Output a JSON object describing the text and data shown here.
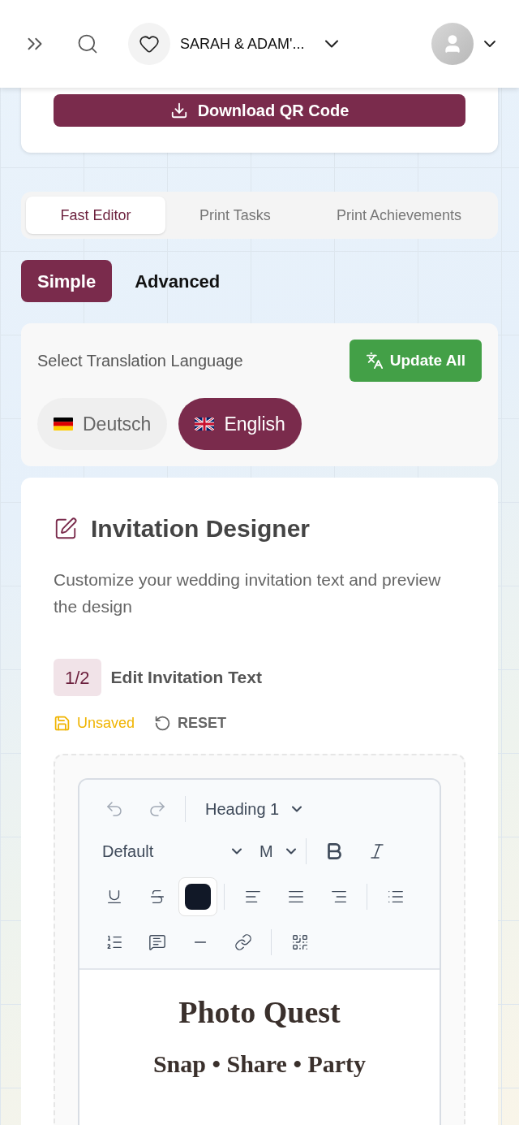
{
  "header": {
    "event_name": "SARAH & ADAM'..."
  },
  "qr_card": {
    "button": "Download QR Code"
  },
  "tabs": [
    {
      "label": "Fast Editor",
      "selected": true
    },
    {
      "label": "Print Tasks",
      "selected": false
    },
    {
      "label": "Print Achievements",
      "selected": false
    }
  ],
  "modes": [
    {
      "label": "Simple",
      "selected": true
    },
    {
      "label": "Advanced",
      "selected": false
    }
  ],
  "translation": {
    "title": "Select Translation Language",
    "button": "Update All",
    "languages": [
      {
        "label": "Deutsch",
        "kind": "de",
        "selected": false
      },
      {
        "label": "English",
        "kind": "en",
        "selected": true
      }
    ]
  },
  "designer": {
    "title": "Invitation Designer",
    "description": "Customize your wedding invitation text and preview the design",
    "step": "1/2",
    "step_title": "Edit Invitation Text",
    "status": "Unsaved",
    "reset": "RESET",
    "toolbar": {
      "undo_disabled": true,
      "redo_disabled": true,
      "block_style": "Heading 1",
      "font": "Default",
      "size": "M",
      "color": "#111827"
    },
    "preview": {
      "title": "Photo Quest",
      "subtitle": "Snap • Share • Party"
    }
  }
}
